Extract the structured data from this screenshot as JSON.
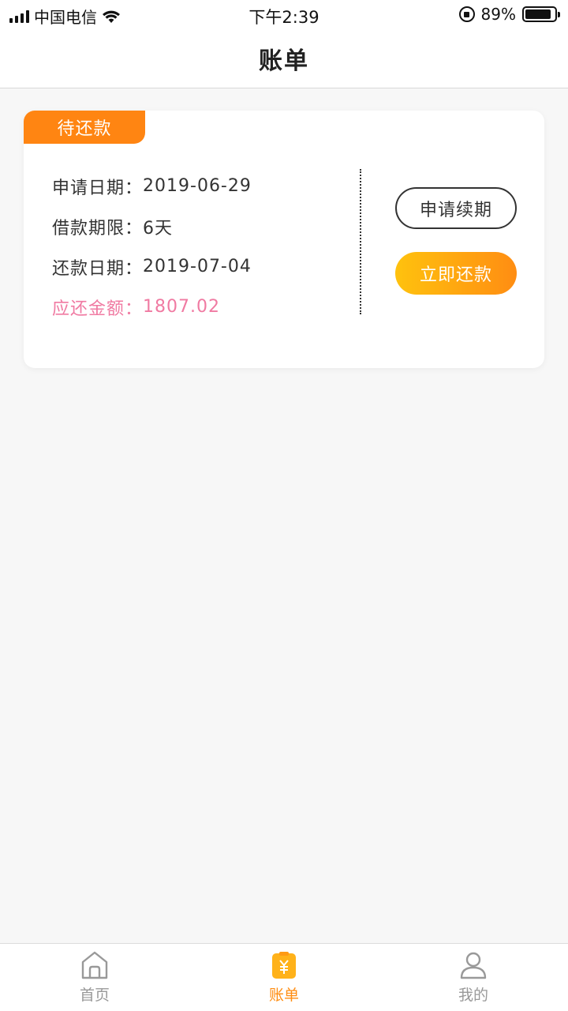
{
  "status_bar": {
    "carrier": "中国电信",
    "time": "下午2:39",
    "battery": "89%",
    "battery_level": 0.89
  },
  "nav": {
    "title": "账单"
  },
  "bill": {
    "status": "待还款",
    "rows": [
      {
        "label": "申请日期：",
        "value": "2019-06-29"
      },
      {
        "label": "借款期限：",
        "value": "6天"
      },
      {
        "label": "还款日期：",
        "value": "2019-07-04"
      },
      {
        "label": "应还金额：",
        "value": "1807.02"
      }
    ],
    "renew_label": "申请续期",
    "repay_label": "立即还款"
  },
  "tabs": [
    {
      "label": "首页",
      "icon": "home-icon",
      "active": false
    },
    {
      "label": "账单",
      "icon": "bill-icon",
      "active": true
    },
    {
      "label": "我的",
      "icon": "profile-icon",
      "active": false
    }
  ],
  "colors": {
    "accent": "#ff8d12",
    "status_tag": "#ff8512",
    "amount": "#f07aa2",
    "button_gradient_start": "#ffc20e",
    "button_gradient_end": "#ff8d12"
  }
}
